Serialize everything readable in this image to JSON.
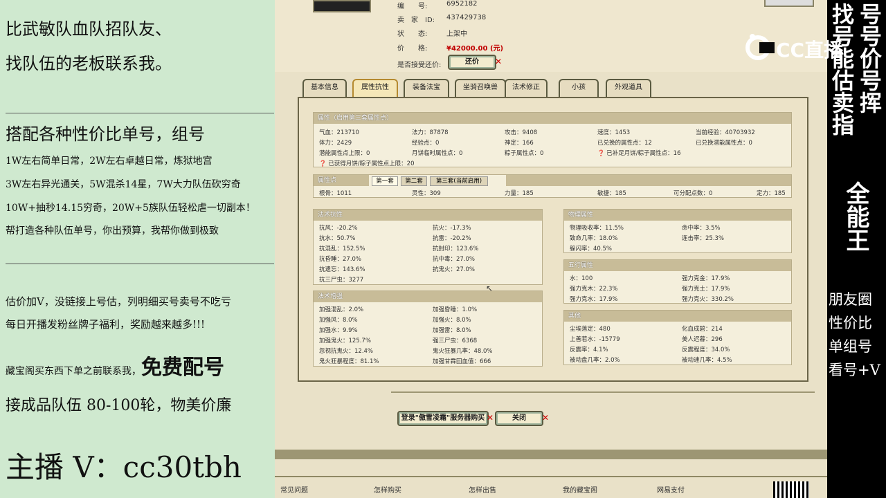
{
  "left": {
    "line1": "比武敏队血队招队友、",
    "line2": "找队伍的老板联系我。",
    "line3": "搭配各种性价比单号，组号",
    "line4": "1W左右简单日常，2W左右卓越日常，炼狱地宫",
    "line5": "3W左右异光通关，5W混杀14星，7W大力队伍砍穷奇",
    "line6": "10W+抽秒14.15穷奇，20W+5族队伍轻松虐一切副本！",
    "line7": "帮打造各种队伍单号，你出预算，我帮你做到极致",
    "line8": "估价加V，没链接上号估，列明细买号卖号不吃亏",
    "line9": "每日开播发粉丝牌子福利，奖励越来越多!!!",
    "line10a": "藏宝阁买东西下单之前联系我，",
    "line10b": "免费配号",
    "line11": "接成品队伍 80-100轮，物美价廉",
    "line12": "主播 V：cc30tbh"
  },
  "header": {
    "id_label": "编　　号:",
    "id_value": "6952182",
    "seller_label": "卖　家　ID:",
    "seller_value": "437429738",
    "status_label": "状　　态:",
    "status_value": "上架中",
    "price_label": "价　　格:",
    "price_value": "¥42000.00 (元)",
    "bargain_label": "是否接受还价:",
    "bargain_button": "还价"
  },
  "tabs": [
    "基本信息",
    "属性抗性",
    "装备法宝",
    "坐骑召唤兽",
    "法术修正",
    "小孩",
    "外观道具"
  ],
  "attr": {
    "title": "属性（启用第三套属性点）",
    "rows": [
      [
        "气血：213710",
        "法力：87878",
        "攻击：9408",
        "速度：1453",
        "当前经验：40703932"
      ],
      [
        "体力：2429",
        "经验点：0",
        "神定：166",
        "已兑换的属性点：12",
        "已兑换潜能属性点：0"
      ],
      [
        "潜能属性点上限：0",
        "月饼临时属性点：0",
        "粽子属性点：0",
        "已补足月饼/粽子属性点：16",
        ""
      ]
    ],
    "note": "已获得月饼/粽子属性点上限：20"
  },
  "points": {
    "title": "属性点",
    "subtabs": [
      "第一套",
      "第二套",
      "第三套(当前启用)"
    ],
    "row": [
      "根骨：1011",
      "灵性：309",
      "力量：185",
      "敏捷：185",
      "可分配点数：0",
      "定力：185"
    ]
  },
  "resist": {
    "title": "法术抗性",
    "left": [
      "抗风：-20.2%",
      "抗水：50.7%",
      "抗混乱：152.5%",
      "抗昏睡：27.0%",
      "抗遗忘：143.6%",
      "抗三尸虫：3277"
    ],
    "right": [
      "抗火：-17.3%",
      "抗雷：-20.2%",
      "抗封印：123.6%",
      "抗中毒：27.0%",
      "抗鬼火：27.0%"
    ]
  },
  "enhance": {
    "title": "法术增强",
    "left": [
      "加强混乱：2.0%",
      "加强风：8.0%",
      "加强水：9.9%",
      "加强鬼火：125.7%",
      "忽视抗鬼火：12.4%",
      "鬼火狂暴程度：81.1%"
    ],
    "right": [
      "加强昏睡：1.0%",
      "加强火：8.0%",
      "加强雷：8.0%",
      "强三尸虫：6368",
      "鬼火狂暴几率：48.0%",
      "加强甘霖回血值：666"
    ]
  },
  "physical": {
    "title": "物理属性",
    "left": [
      "物理吸收率：11.5%",
      "致命几率：18.0%",
      "躲闪率：40.5%"
    ],
    "right": [
      "命中率：3.5%",
      "连击率：25.3%"
    ]
  },
  "five": {
    "title": "五行属性",
    "left": [
      "水：100",
      "强力克木：22.3%",
      "强力克水：17.9%"
    ],
    "right": [
      "强力克金：17.9%",
      "强力克土：17.9%",
      "强力克火：330.2%"
    ]
  },
  "other": {
    "title": "其他",
    "left": [
      "尘埃落定：480",
      "上善若水：-15779",
      "反震率：4.1%",
      "被动盘几率：2.0%"
    ],
    "right": [
      "化血成碧：214",
      "美人迟暮：296",
      "反震程度：34.0%",
      "被动速几率：4.5%"
    ]
  },
  "bottom_buttons": {
    "login": "登录\"傲雪凌霜\"服务器购买",
    "close": "关闭"
  },
  "footer": [
    "常见问题",
    "怎样购买",
    "怎样出售",
    "我的藏宝阁",
    "网易支付"
  ],
  "right": {
    "col1": "找号能估卖指",
    "col2": "号号价号挥",
    "col3": "全能王",
    "lines": [
      "朋友圈",
      "性价比",
      "单组号",
      "看号+V"
    ],
    "logo": "CC直播"
  },
  "colors": {
    "left_bg": "#cfe9cf",
    "game_bg": "#e9e1c8",
    "price_red": "#c00000",
    "header_bar": "#c8bc98"
  }
}
